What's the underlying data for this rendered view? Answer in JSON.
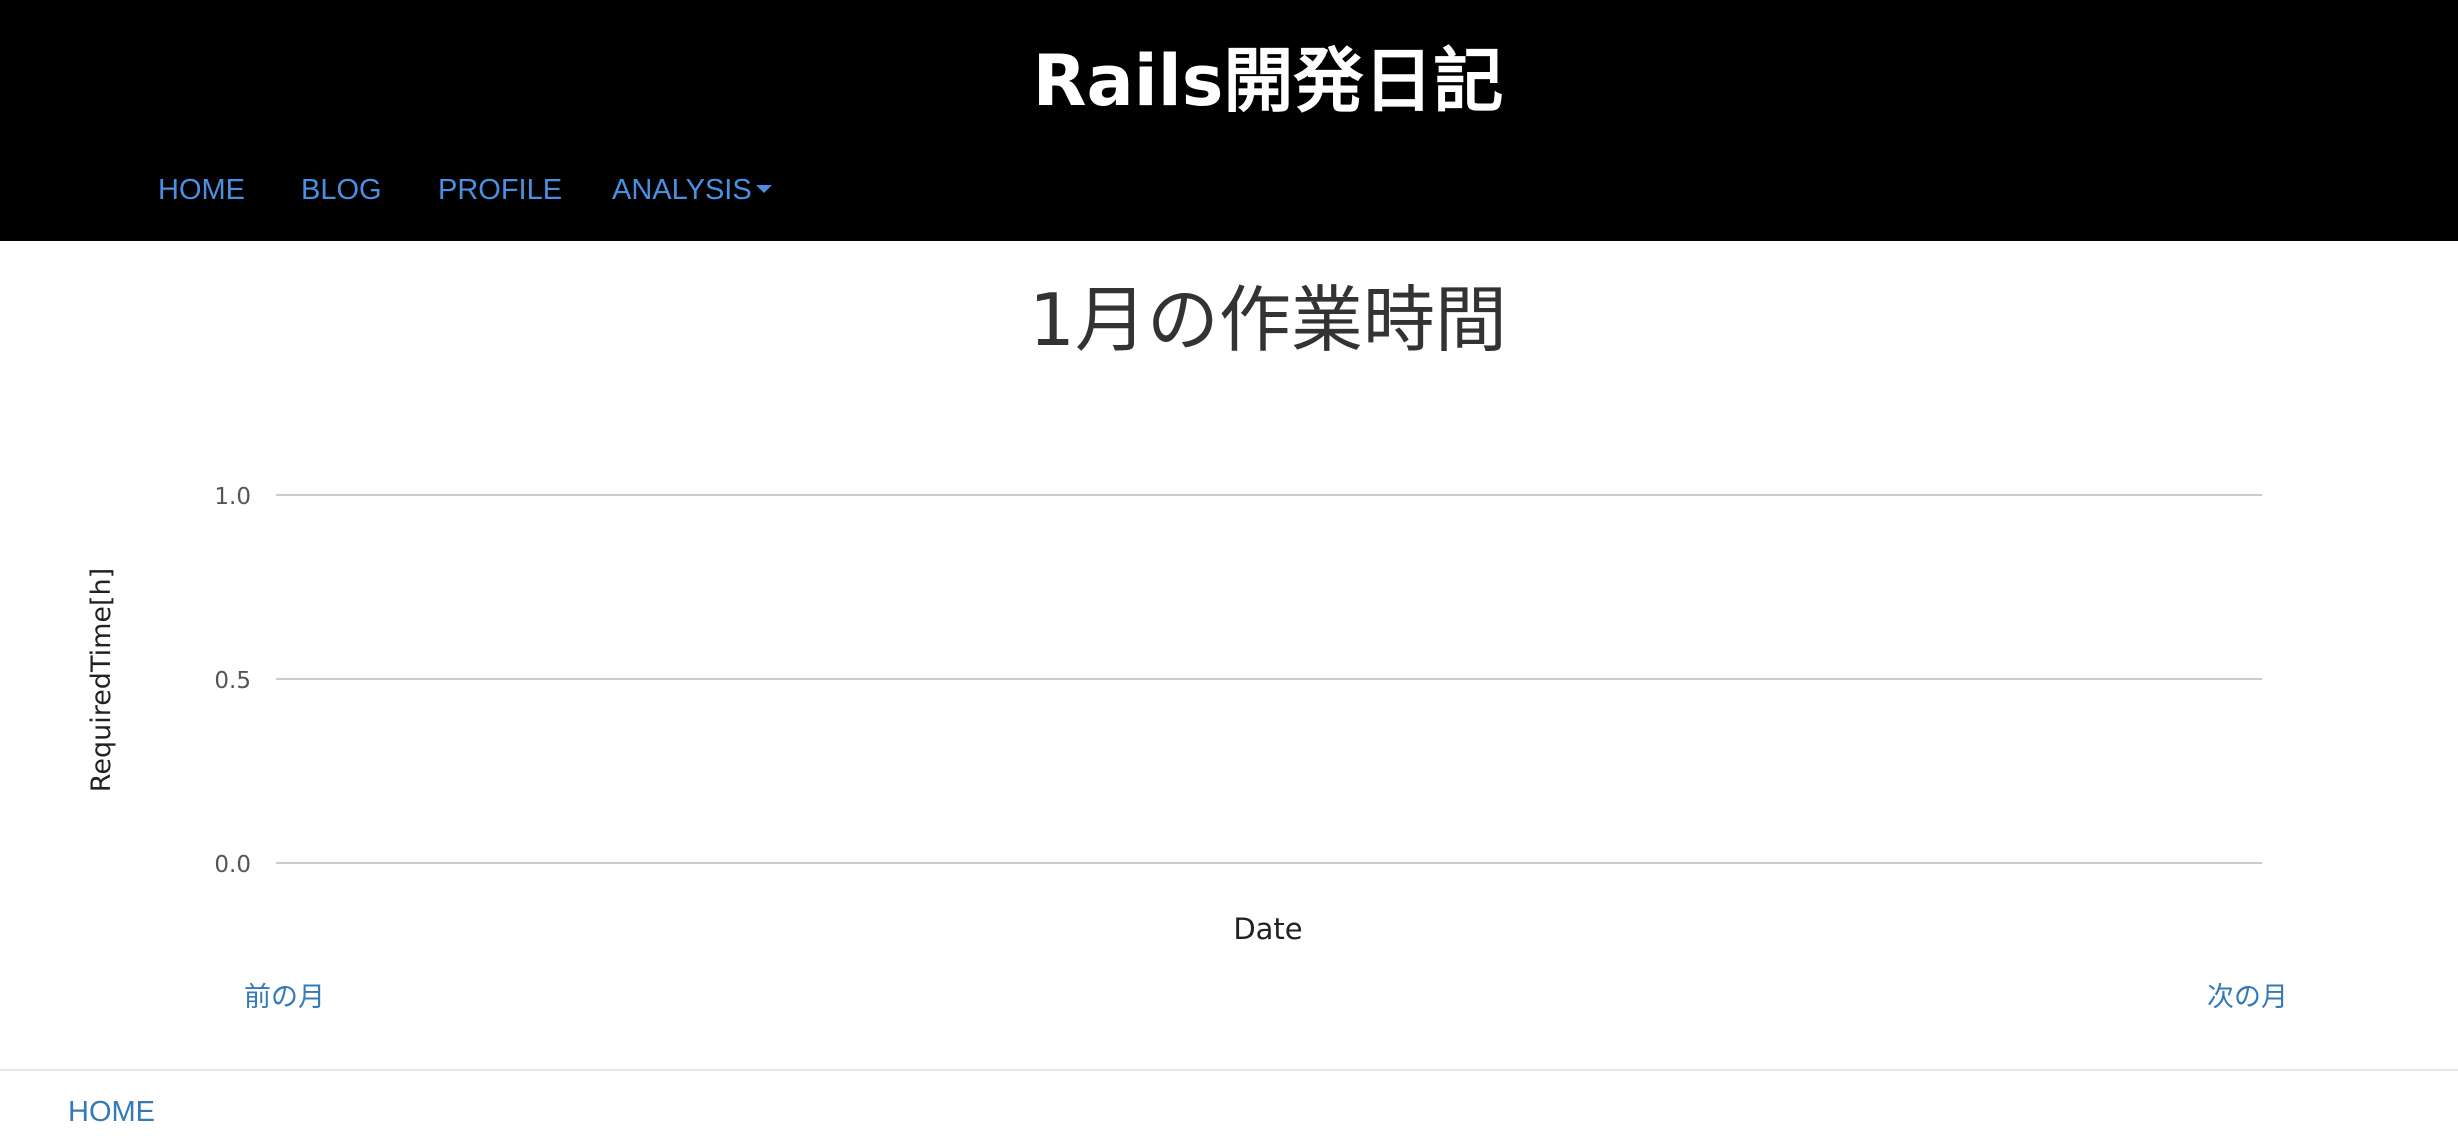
{
  "site": {
    "title": "Rails開発日記"
  },
  "nav": {
    "items": [
      {
        "label": "HOME"
      },
      {
        "label": "BLOG"
      },
      {
        "label": "PROFILE"
      },
      {
        "label": "ANALYSIS",
        "has_dropdown": true
      }
    ]
  },
  "page": {
    "heading": "1月の作業時間"
  },
  "chart_data": {
    "type": "bar",
    "title": "",
    "xlabel": "Date",
    "ylabel": "RequiredTime[h]",
    "ylim": [
      0,
      1.0
    ],
    "yticks": [
      "0.0",
      "0.5",
      "1.0"
    ],
    "categories": [],
    "values": [],
    "grid": true,
    "legend": "none"
  },
  "pager": {
    "prev_label": "前の月",
    "next_label": "次の月"
  },
  "footer": {
    "home_label": "HOME"
  },
  "colors": {
    "header_bg": "#000000",
    "nav_link": "#4a90e2",
    "link": "#337ab7",
    "heading": "#333333",
    "gridline": "#cccccc"
  }
}
